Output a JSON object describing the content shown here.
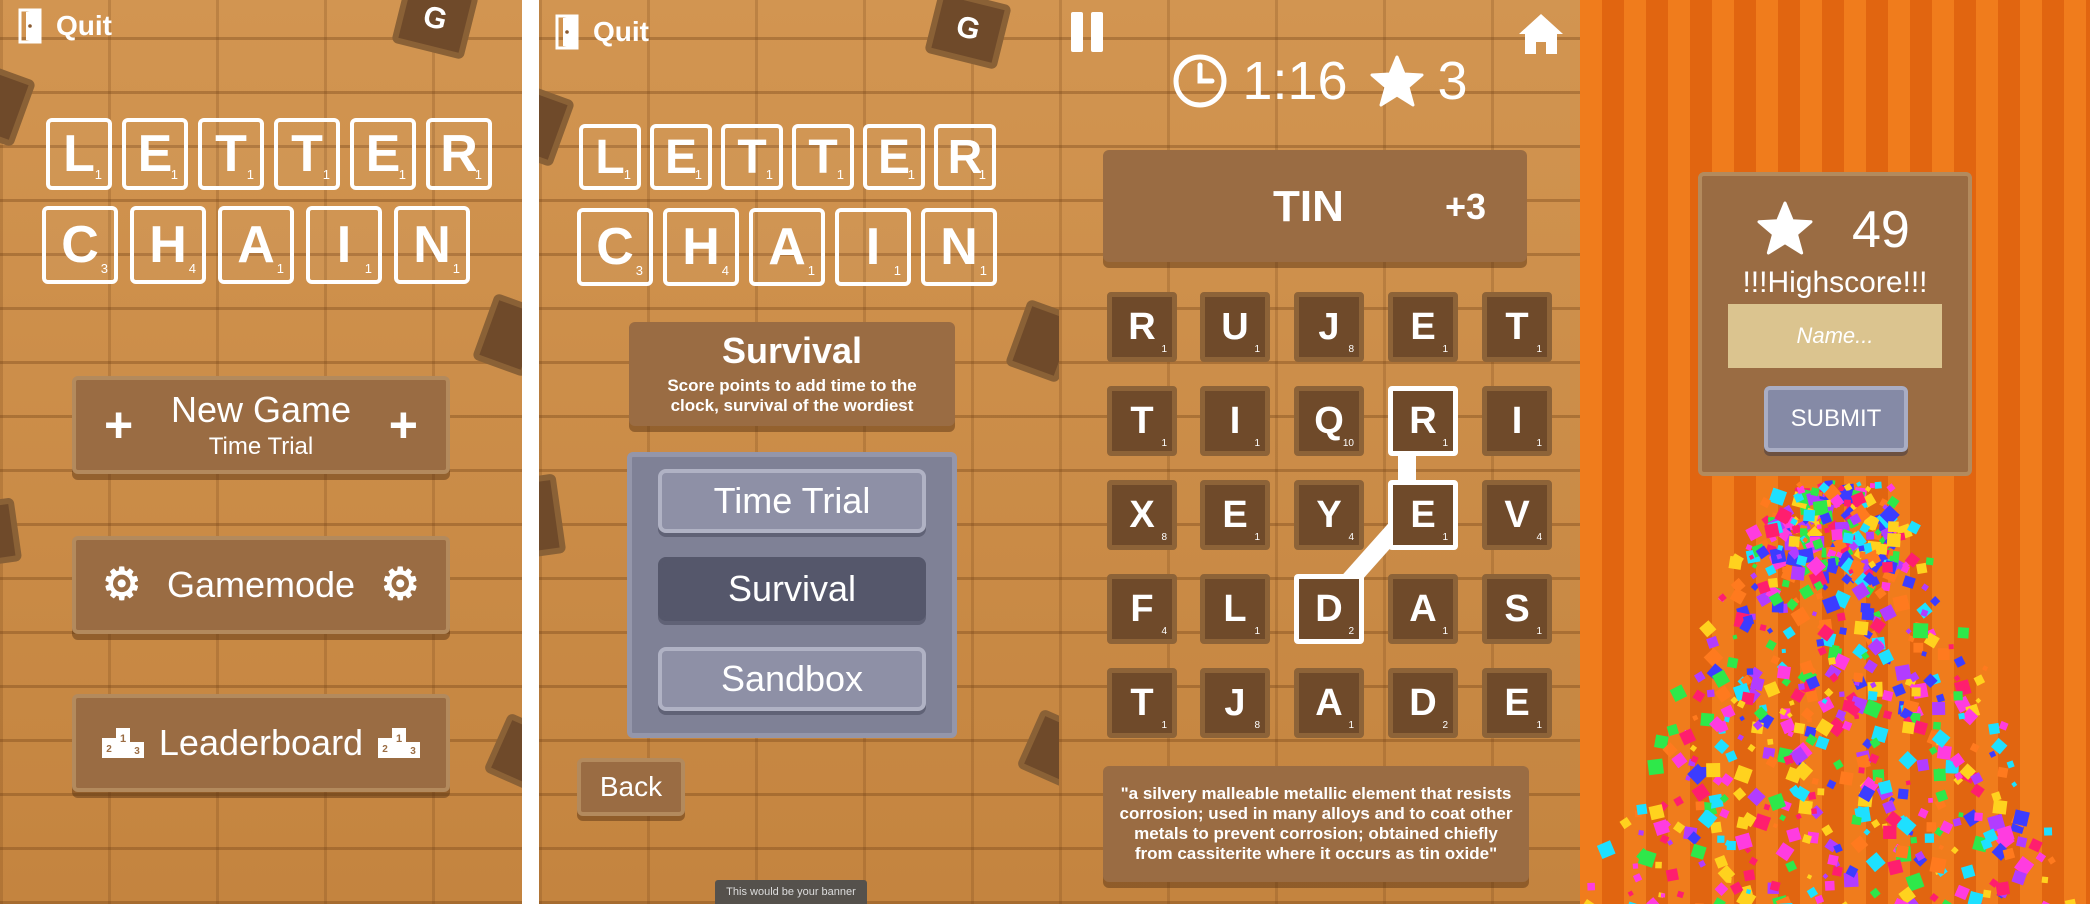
{
  "colors": {
    "wood_background": "#c98c47",
    "wood_button": "#9a6c43",
    "tile_dark": "#6f4a2a",
    "mode_panel": "#7f8196",
    "mode_selected": "#55576b",
    "orange_background": "#ea6f11",
    "name_input": "#dbc48f",
    "submit_button": "#858aa6"
  },
  "title": {
    "row1": [
      {
        "letter": "L",
        "points": "1"
      },
      {
        "letter": "E",
        "points": "1"
      },
      {
        "letter": "T",
        "points": "1"
      },
      {
        "letter": "T",
        "points": "1"
      },
      {
        "letter": "E",
        "points": "1"
      },
      {
        "letter": "R",
        "points": "1"
      }
    ],
    "row2": [
      {
        "letter": "C",
        "points": "3"
      },
      {
        "letter": "H",
        "points": "4"
      },
      {
        "letter": "A",
        "points": "1"
      },
      {
        "letter": "I",
        "points": "1"
      },
      {
        "letter": "N",
        "points": "1"
      }
    ]
  },
  "main_menu": {
    "quit_label": "Quit",
    "quit_icon": "door-icon",
    "deco_tile_letter": "G",
    "new_game_label": "New Game",
    "new_game_mode": "Time Trial",
    "new_game_icon": "plus-icon",
    "gamemode_label": "Gamemode",
    "gamemode_icon": "gear-icon",
    "leaderboard_label": "Leaderboard",
    "leaderboard_icon": "podium-icon"
  },
  "gamemode_menu": {
    "quit_label": "Quit",
    "deco_tile_letter": "G",
    "mode_title": "Survival",
    "mode_description": "Score points to add time to the clock, survival of the wordiest",
    "options": [
      "Time Trial",
      "Survival",
      "Sandbox"
    ],
    "selected_option": "Survival",
    "back_label": "Back",
    "banner_text": "This would be your banner"
  },
  "game": {
    "pause_icon": "pause-icon",
    "home_icon": "home-icon",
    "clock_icon": "clock-icon",
    "star_icon": "star-icon",
    "timer": "1:16",
    "score": "3",
    "current_word": "TIN",
    "word_points": "+3",
    "grid": [
      [
        {
          "l": "R",
          "p": "1"
        },
        {
          "l": "U",
          "p": "1"
        },
        {
          "l": "J",
          "p": "8"
        },
        {
          "l": "E",
          "p": "1"
        },
        {
          "l": "T",
          "p": "1"
        }
      ],
      [
        {
          "l": "T",
          "p": "1"
        },
        {
          "l": "I",
          "p": "1"
        },
        {
          "l": "Q",
          "p": "10"
        },
        {
          "l": "R",
          "p": "1"
        },
        {
          "l": "I",
          "p": "1"
        }
      ],
      [
        {
          "l": "X",
          "p": "8"
        },
        {
          "l": "E",
          "p": "1"
        },
        {
          "l": "Y",
          "p": "4"
        },
        {
          "l": "E",
          "p": "1"
        },
        {
          "l": "V",
          "p": "4"
        }
      ],
      [
        {
          "l": "F",
          "p": "4"
        },
        {
          "l": "L",
          "p": "1"
        },
        {
          "l": "D",
          "p": "2"
        },
        {
          "l": "A",
          "p": "1"
        },
        {
          "l": "S",
          "p": "1"
        }
      ],
      [
        {
          "l": "T",
          "p": "1"
        },
        {
          "l": "J",
          "p": "8"
        },
        {
          "l": "A",
          "p": "1"
        },
        {
          "l": "D",
          "p": "2"
        },
        {
          "l": "E",
          "p": "1"
        }
      ]
    ],
    "selected_path": "R-E-D",
    "definition": "\"a silvery malleable metallic element that resists corrosion; used in many alloys and to coat other metals to prevent corrosion; obtained chiefly from cassiterite where it occurs as tin oxide\""
  },
  "highscore": {
    "star_icon": "star-icon",
    "score": "49",
    "message": "!!!Highscore!!!",
    "name_placeholder": "Name...",
    "submit_label": "SUBMIT"
  }
}
